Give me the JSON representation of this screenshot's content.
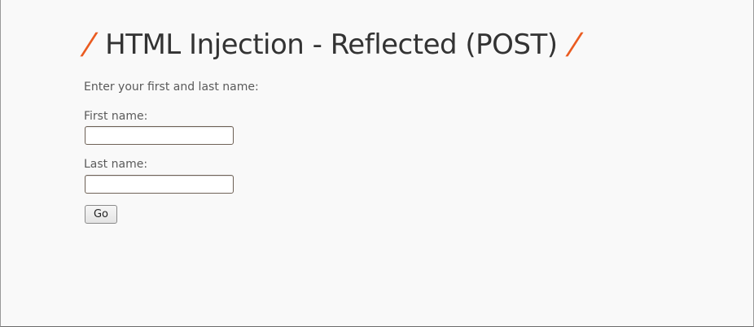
{
  "page": {
    "title": "HTML Injection - Reflected (POST)",
    "title_decoration": "/",
    "intro": "Enter your first and last name:"
  },
  "form": {
    "first_name_label": "First name:",
    "first_name_value": "",
    "last_name_label": "Last name:",
    "last_name_value": "",
    "submit_label": "Go"
  },
  "colors": {
    "accent": "#ea5b20",
    "heading": "#333333",
    "text": "#5a5a5a",
    "background": "#f9f9f9"
  }
}
